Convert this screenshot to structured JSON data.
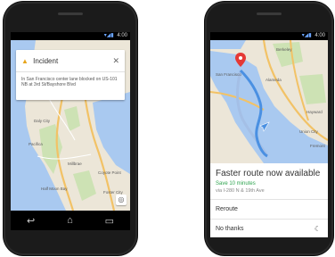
{
  "left_phone": {
    "status_time": "4:00",
    "incident": {
      "title": "Incident",
      "body": "In San Francisco center lane blocked on US-101 NB at 3rd St/Bayshore Blvd"
    },
    "map_labels": [
      "Daly City",
      "Pacifica",
      "Millbrae",
      "Half Moon Bay",
      "Coyote Point",
      "Foster City"
    ]
  },
  "right_phone": {
    "status_time": "4:00",
    "map_labels": [
      "Berkeley",
      "San Francisco",
      "Alameda",
      "Hayward",
      "Union City",
      "Fremont"
    ],
    "route_panel": {
      "title": "Faster route now available",
      "savings": "Save 10 minutes",
      "via": "via I-280 N & 19th Ave",
      "reroute_label": "Reroute",
      "no_thanks_label": "No thanks"
    }
  },
  "icons": {
    "warning": "warning-icon",
    "close": "close-icon",
    "back": "back-icon",
    "home": "home-icon",
    "recent": "recent-apps-icon",
    "locate": "my-location-icon",
    "night": "moon-icon",
    "pin": "map-pin-icon",
    "nav_arrow": "navigation-arrow-icon"
  },
  "colors": {
    "water": "#a9c9f0",
    "land": "#ece6d8",
    "park": "#cde2b4",
    "highway": "#f2c266",
    "route_main": "#4a90e2",
    "route_alt": "#a4bfe6",
    "accent_green": "#2ea44f",
    "warning": "#e7a51c",
    "pin": "#e53935"
  }
}
